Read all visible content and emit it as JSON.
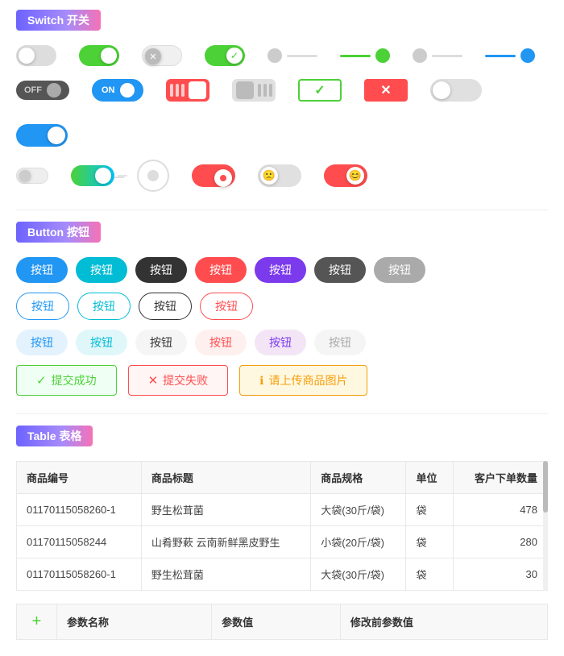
{
  "header": {
    "switch_badge": "Switch 开关",
    "button_badge": "Button 按钮",
    "table_badge": "Table 表格"
  },
  "switches": {
    "row1": [
      {
        "type": "off",
        "label": "off-gray"
      },
      {
        "type": "on-green",
        "label": "on-green"
      },
      {
        "type": "off-x",
        "label": "off-x"
      },
      {
        "type": "on-check",
        "label": "on-check"
      },
      {
        "type": "line-off",
        "label": "line-off"
      },
      {
        "type": "line-on-green",
        "label": "line-on-green"
      },
      {
        "type": "line-off2",
        "label": "line-off2"
      },
      {
        "type": "line-on-blue",
        "label": "line-on-blue"
      }
    ],
    "row2": [
      {
        "type": "label-off",
        "text": "OFF"
      },
      {
        "type": "label-on",
        "text": "ON"
      },
      {
        "type": "bars-red"
      },
      {
        "type": "bars-gray"
      },
      {
        "type": "box-check"
      },
      {
        "type": "box-x"
      },
      {
        "type": "wide-off"
      },
      {
        "type": "wide-on"
      }
    ],
    "row3": [
      {
        "type": "small-off"
      },
      {
        "type": "gradient-on"
      },
      {
        "type": "circle-off"
      },
      {
        "type": "red-dot"
      },
      {
        "type": "gray-face"
      },
      {
        "type": "sad-face"
      }
    ]
  },
  "buttons": {
    "row1": [
      "按钮",
      "按钮",
      "按钮",
      "按钮",
      "按钮",
      "按钮",
      "按钮"
    ],
    "row1_styles": [
      "btn-blue",
      "btn-teal",
      "btn-dark",
      "btn-red",
      "btn-purple",
      "btn-darkgray",
      "btn-gray"
    ],
    "row2": [
      "按钮",
      "按钮",
      "按钮",
      "按钮"
    ],
    "row2_styles": [
      "btn-outline-blue",
      "btn-outline-teal",
      "btn-outline-dark",
      "btn-outline-red"
    ],
    "row3": [
      "按钮",
      "按钮",
      "按钮",
      "按钮",
      "按钮",
      "按钮"
    ],
    "row3_styles": [
      "btn-light-blue",
      "btn-light-teal",
      "btn-light-dark",
      "btn-light-red",
      "btn-light-purple",
      "btn-light-gray"
    ],
    "status": [
      {
        "label": "提交成功",
        "style": "btn-status-success",
        "icon": "✓"
      },
      {
        "label": "提交失败",
        "style": "btn-status-error",
        "icon": "✕"
      },
      {
        "label": "请上传商品图片",
        "style": "btn-status-warning",
        "icon": "ℹ"
      }
    ]
  },
  "table": {
    "headers": [
      "商品编号",
      "商品标题",
      "商品规格",
      "单位",
      "客户下单数量"
    ],
    "rows": [
      [
        "01170115058260-1",
        "野生松茸菌",
        "大袋(30斤/袋)",
        "袋",
        "478"
      ],
      [
        "01170115058244",
        "山肴野蔌 云南新鲜黑皮野生",
        "小袋(20斤/袋)",
        "袋",
        "280"
      ],
      [
        "01170115058260-1",
        "野生松茸菌",
        "大袋(30斤/袋)",
        "袋",
        "30"
      ]
    ]
  },
  "bottom_table": {
    "add_icon": "+",
    "headers": [
      "参数名称",
      "参数值",
      "修改前参数值"
    ]
  }
}
